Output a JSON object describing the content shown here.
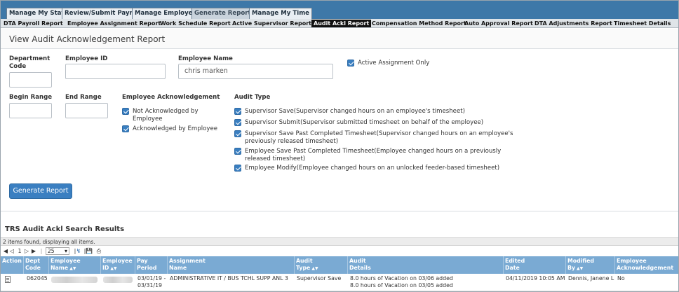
{
  "top_tabs": [
    {
      "label": "Manage My Staff"
    },
    {
      "label": "Review/Submit Payroll"
    },
    {
      "label": "Manage Employee"
    },
    {
      "label": "Generate Reports"
    },
    {
      "label": "Manage My Time"
    }
  ],
  "sub_nav": [
    {
      "label": "DTA Payroll Report"
    },
    {
      "label": "Employee Assignment Report"
    },
    {
      "label": "Work Schedule Report"
    },
    {
      "label": "Active Supervisor Report"
    },
    {
      "label": "Audit Ackl Report"
    },
    {
      "label": "Compensation Method Report"
    },
    {
      "label": "Auto Approval Report"
    },
    {
      "label": "DTA Adjustments Report"
    },
    {
      "label": "Timesheet Details"
    }
  ],
  "page_title": "View Audit Acknowledgement Report",
  "form": {
    "dept_code_label": "Department Code",
    "dept_code_value": "",
    "employee_id_label": "Employee ID",
    "employee_id_value": "",
    "employee_name_label": "Employee Name",
    "employee_name_value": "chris marken",
    "active_assignment_label": "Active Assignment Only",
    "begin_range_label": "Begin Range",
    "end_range_label": "End Range",
    "ack_label": "Employee Acknowledgement",
    "ack_options": [
      {
        "label_line1": "Not Acknowledged by",
        "label_line2": "Employee",
        "checked": true
      },
      {
        "label_line1": "Acknowledged by Employee",
        "label_line2": "",
        "checked": true
      }
    ],
    "audit_type_label": "Audit Type",
    "audit_types": [
      {
        "line1": "Supervisor Save(Supervisor changed hours on an employee's timesheet)",
        "line2": "",
        "checked": true
      },
      {
        "line1": "Supervisor Submit(Supervisor submitted timesheet on behalf of the employee)",
        "line2": "",
        "checked": true
      },
      {
        "line1": "Supervisor Save Past Completed Timesheet(Supervisor changed hours on an employee's",
        "line2": "previously released timesheet)",
        "checked": true
      },
      {
        "line1": "Employee Save Past Completed Timesheet(Employee changed hours on a previously",
        "line2": "released timesheet)",
        "checked": true
      },
      {
        "line1": "Employee Modify(Employee changed hours on an unlocked feeder-based timesheet)",
        "line2": "",
        "checked": true
      }
    ],
    "generate_button": "Generate Report"
  },
  "results": {
    "title": "TRS Audit Ackl Search Results",
    "count_text": "2 items found, displaying all items.",
    "pager": {
      "page": "1",
      "page_size": "25"
    },
    "columns": [
      {
        "line1": "Action",
        "line2": "",
        "sortable": false
      },
      {
        "line1": "Dept",
        "line2": "Code",
        "sortable": true
      },
      {
        "line1": "Employee",
        "line2": "Name",
        "sortable": true
      },
      {
        "line1": "Employee",
        "line2": "ID",
        "sortable": true
      },
      {
        "line1": "Pay",
        "line2": "Period",
        "sortable": false
      },
      {
        "line1": "Assignment",
        "line2": "Name",
        "sortable": false
      },
      {
        "line1": "Audit",
        "line2": "Type",
        "sortable": true
      },
      {
        "line1": "Audit",
        "line2": "Details",
        "sortable": false
      },
      {
        "line1": "Edited",
        "line2": "Date",
        "sortable": false
      },
      {
        "line1": "Modified",
        "line2": "By",
        "sortable": true
      },
      {
        "line1": "Employee",
        "line2": "Acknowledgement",
        "sortable": true
      }
    ],
    "rows": [
      {
        "dept_code": "062045",
        "pay_period_line1": "03/01/19 -",
        "pay_period_line2": "03/31/19",
        "assignment": "ADMINISTRATIVE IT / BUS TCHL SUPP ANL 3",
        "audit_type": "Supervisor Save",
        "details_line1": "8.0 hours of Vacation on 03/06 added",
        "details_line2": "8.0 hours of Vacation on 03/05 added",
        "edited_date": "04/11/2019 10:05 AM",
        "modified_by": "Dennis, Janene L",
        "acknowledgement": "No"
      }
    ]
  },
  "colors": {
    "topbar": "#3e78a8",
    "accent": "#3a7fc1",
    "table_header": "#7aaad3"
  }
}
